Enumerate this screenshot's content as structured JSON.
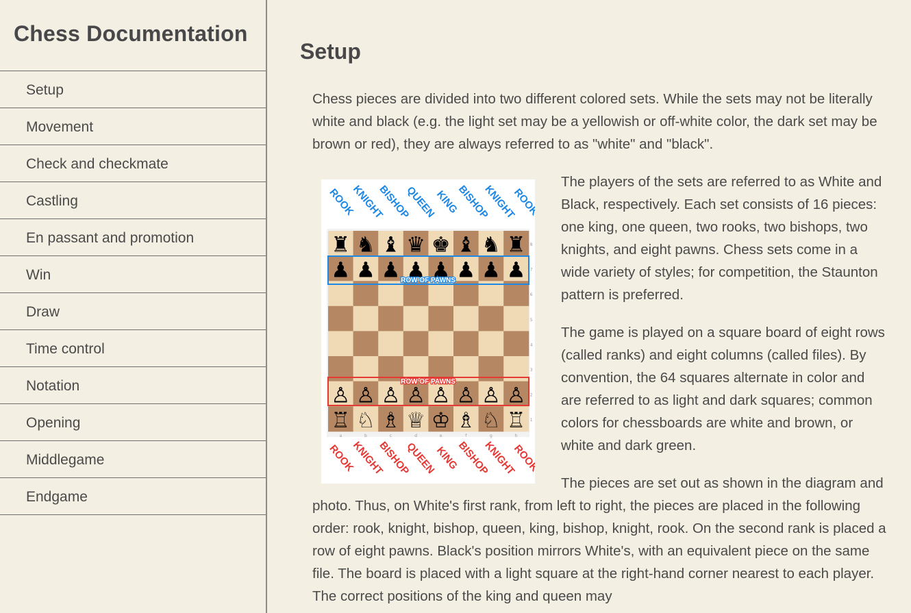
{
  "sidebar": {
    "title": "Chess Documentation",
    "items": [
      {
        "label": "Setup"
      },
      {
        "label": "Movement"
      },
      {
        "label": "Check and checkmate"
      },
      {
        "label": "Castling"
      },
      {
        "label": "En passant and promotion"
      },
      {
        "label": "Win"
      },
      {
        "label": "Draw"
      },
      {
        "label": "Time control"
      },
      {
        "label": "Notation"
      },
      {
        "label": "Opening"
      },
      {
        "label": "Middlegame"
      },
      {
        "label": "Endgame"
      }
    ]
  },
  "main": {
    "heading": "Setup",
    "paragraphs": [
      "Chess pieces are divided into two different colored sets. While the sets may not be literally white and black (e.g. the light set may be a yellowish or off-white color, the dark set may be brown or red), they are always referred to as \"white\" and \"black\".",
      "The players of the sets are referred to as White and Black, respectively. Each set consists of 16 pieces: one king, one queen, two rooks, two bishops, two knights, and eight pawns. Chess sets come in a wide variety of styles; for competition, the Staunton pattern is preferred.",
      "The game is played on a square board of eight rows (called ranks) and eight columns (called files). By convention, the 64 squares alternate in color and are referred to as light and dark squares; common colors for chessboards are white and brown, or white and dark green.",
      "The pieces are set out as shown in the diagram and photo. Thus, on White's first rank, from left to right, the pieces are placed in the following order: rook, knight, bishop, queen, king, bishop, knight, rook. On the second rank is placed a row of eight pawns. Black's position mirrors White's, with an equivalent piece on the same file. The board is placed with a light square at the right-hand corner nearest to each player. The correct positions of the king and queen may"
    ]
  },
  "diagram": {
    "top_labels": [
      "ROOK",
      "KNIGHT",
      "BISHOP",
      "QUEEN",
      "KING",
      "BISHOP",
      "KNIGHT",
      "ROOK"
    ],
    "bottom_labels": [
      "ROOK",
      "KNIGHT",
      "BISHOP",
      "QUEEN",
      "KING",
      "BISHOP",
      "KNIGHT",
      "ROOK"
    ],
    "black_pawn_label": "ROW OF PAWNS",
    "white_pawn_label": "ROW OF PAWNS",
    "files": [
      "a",
      "b",
      "c",
      "d",
      "e",
      "f",
      "g",
      "h"
    ],
    "ranks": [
      "8",
      "7",
      "6",
      "5",
      "4",
      "3",
      "2",
      "1"
    ],
    "black_back_rank": [
      "♜",
      "♞",
      "♝",
      "♛",
      "♚",
      "♝",
      "♞",
      "♜"
    ],
    "black_pawn": "♟",
    "white_back_rank": [
      "♖",
      "♘",
      "♗",
      "♕",
      "♔",
      "♗",
      "♘",
      "♖"
    ],
    "white_pawn": "♙",
    "colors": {
      "light_square": "#f0d9b5",
      "dark_square": "#b58863",
      "black_label": "#1e88e5",
      "white_label": "#e53935",
      "black_row_border": "#1e88e5",
      "white_row_border": "#e53935"
    }
  }
}
